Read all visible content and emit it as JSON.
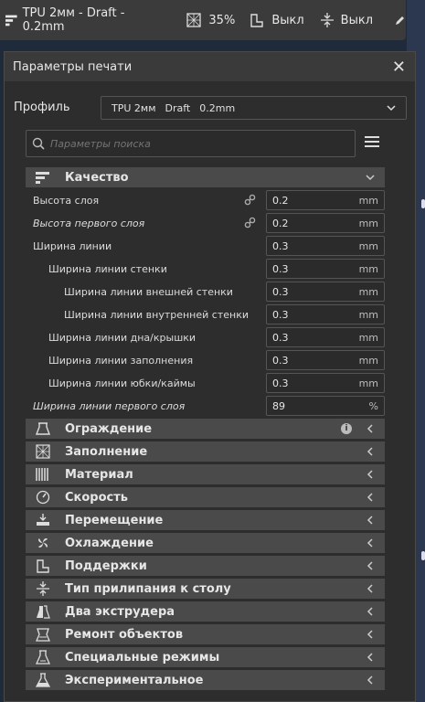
{
  "topbar": {
    "profile_name": "TPU 2мм - Draft - 0.2mm",
    "infill": "35%",
    "support": "Выкл",
    "adhesion": "Выкл"
  },
  "panel": {
    "title": "Параметры печати",
    "profile_label": "Профиль",
    "profile_value": {
      "material": "TPU 2мм",
      "quality": "Draft",
      "layer": "0.2mm"
    },
    "search_placeholder": "Параметры поиска"
  },
  "quality": {
    "label": "Качество",
    "rows": [
      {
        "label": "Высота слоя",
        "value": "0.2",
        "unit": "mm"
      },
      {
        "label": "Высота первого слоя",
        "value": "0.2",
        "unit": "mm"
      },
      {
        "label": "Ширина линии",
        "value": "0.3",
        "unit": "mm"
      },
      {
        "label": "Ширина линии стенки",
        "value": "0.3",
        "unit": "mm"
      },
      {
        "label": "Ширина линии внешней стенки",
        "value": "0.3",
        "unit": "mm"
      },
      {
        "label": "Ширина линии внутренней стенки",
        "value": "0.3",
        "unit": "mm"
      },
      {
        "label": "Ширина линии дна/крышки",
        "value": "0.3",
        "unit": "mm"
      },
      {
        "label": "Ширина линии заполнения",
        "value": "0.3",
        "unit": "mm"
      },
      {
        "label": "Ширина линии юбки/каймы",
        "value": "0.3",
        "unit": "mm"
      },
      {
        "label": "Ширина линии первого слоя",
        "value": "89",
        "unit": "%"
      }
    ]
  },
  "categories": [
    {
      "label": "Ограждение",
      "icon": "shell-icon"
    },
    {
      "label": "Заполнение",
      "icon": "infill-icon"
    },
    {
      "label": "Материал",
      "icon": "material-icon"
    },
    {
      "label": "Скорость",
      "icon": "speed-icon"
    },
    {
      "label": "Перемещение",
      "icon": "travel-icon"
    },
    {
      "label": "Охлаждение",
      "icon": "cooling-icon"
    },
    {
      "label": "Поддержки",
      "icon": "support-icon"
    },
    {
      "label": "Тип прилипания к столу",
      "icon": "adhesion-icon"
    },
    {
      "label": "Два экструдера",
      "icon": "dual-extrusion-icon"
    },
    {
      "label": "Ремонт объектов",
      "icon": "mesh-fix-icon"
    },
    {
      "label": "Специальные режимы",
      "icon": "special-modes-icon"
    },
    {
      "label": "Экспериментальное",
      "icon": "experimental-icon"
    }
  ]
}
